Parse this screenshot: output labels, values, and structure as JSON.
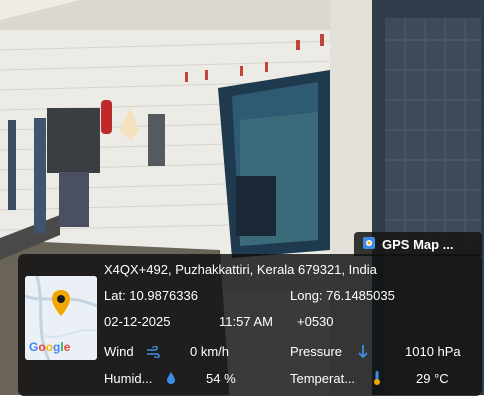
{
  "badge": {
    "title": "GPS Map ...",
    "icon": "gps-map-camera-icon"
  },
  "location": {
    "address": "X4QX+492, Puzhakkattiri, Kerala 679321, India",
    "lat": "Lat: 10.9876336",
    "long": "Long: 76.1485035",
    "date": "02-12-2025",
    "time": "11:57 AM",
    "tz": "+0530"
  },
  "weather": {
    "wind_label": "Wind",
    "wind_value": "0 km/h",
    "pressure_label": "Pressure",
    "pressure_value": "1010 hPa",
    "humidity_label": "Humid...",
    "humidity_value": "54 %",
    "temp_label": "Temperat...",
    "temp_value": "29 °C"
  },
  "map": {
    "logo": "Google",
    "pin_icon": "map-pin-icon"
  },
  "colors": {
    "panel": "#141414",
    "accent_blue": "#3b8de6",
    "pin": "#f2a600"
  }
}
